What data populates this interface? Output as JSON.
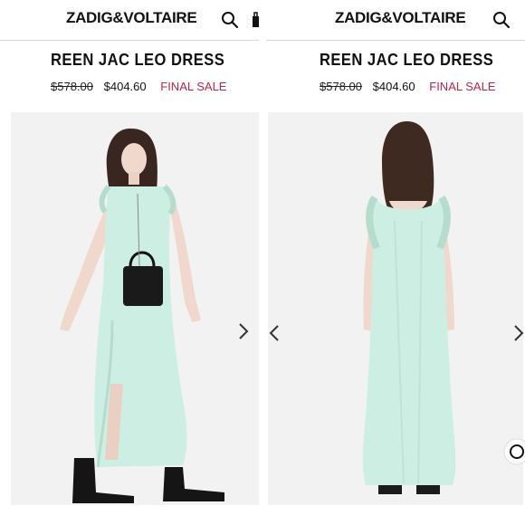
{
  "brand": {
    "logo_text": "ZADIG&VOLTAIRE"
  },
  "product": {
    "title": "REEN JAC LEO DRESS",
    "original_price": "$578.00",
    "sale_price": "$404.60",
    "badge": "FINAL SALE"
  },
  "icons": {
    "search": "search-icon",
    "bag": "bag-icon",
    "next": "chevron-right-icon",
    "prev": "chevron-left-icon",
    "chat": "chat-icon"
  },
  "colors": {
    "sale": "#b8264a",
    "dress": "#cdeee2",
    "photo_bg": "#f1f1f1"
  },
  "images": {
    "front": {
      "alt": "Model in mint green ruffled maxi dress with black handbag, front view"
    },
    "back": {
      "alt": "Model in mint green ruffled maxi dress, back view"
    }
  }
}
